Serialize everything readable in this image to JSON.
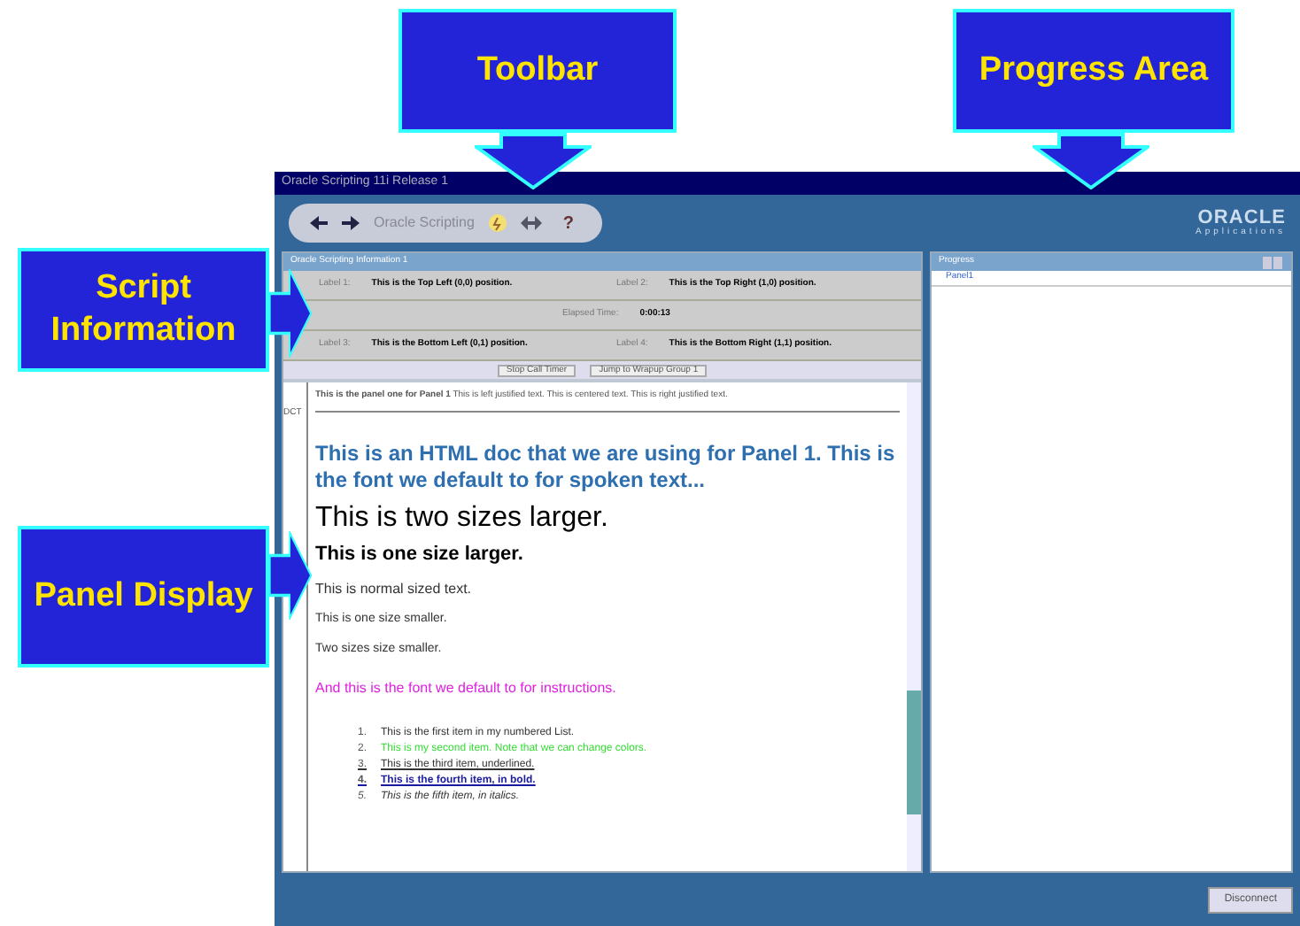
{
  "callouts": [
    {
      "label": "Toolbar",
      "kind": "down"
    },
    {
      "label": "Progress Area",
      "kind": "down"
    },
    {
      "label": "Script Information",
      "kind": "right"
    },
    {
      "label": "Panel Display",
      "kind": "right"
    }
  ],
  "window": {
    "title": "Oracle Scripting 11i Release 1"
  },
  "toolbar": {
    "title": "Oracle Scripting",
    "help": "?"
  },
  "logo": {
    "name": "ORACLE",
    "sub": "Applications"
  },
  "script_info": {
    "title": "Oracle Scripting Information 1",
    "rows": [
      {
        "kind": "pair",
        "cells": [
          {
            "label": "Label 1:",
            "value": "This is the Top Left (0,0) position."
          },
          {
            "label": "Label 2:",
            "value": "This is the Top Right (1,0) position."
          }
        ]
      },
      {
        "kind": "single",
        "label": "Elapsed Time:",
        "value": "0:00:13"
      },
      {
        "kind": "pair",
        "cells": [
          {
            "label": "Label 3:",
            "value": "This is the Bottom Left (0,1) position."
          },
          {
            "label": "Label 4:",
            "value": "This is the Bottom Right (1,1) position."
          }
        ]
      }
    ],
    "buttons": [
      "Stop Call Timer",
      "Jump to Wrapup Group 1"
    ]
  },
  "panel": {
    "side_label": "DCT",
    "header": "**This is the panel one for Panel 1** This is left justified text. This is centered text. This is right justified text.",
    "lines": [
      {
        "kind": "lead",
        "text": "This is an HTML doc that we are using for Panel 1. This is the font we default to for spoken text..."
      },
      {
        "kind": "large2",
        "text": "This is two sizes larger."
      },
      {
        "kind": "large1",
        "text": "This is one size larger."
      },
      {
        "kind": "normal",
        "text": "This is normal sized text."
      },
      {
        "kind": "small",
        "text": "This is one size smaller."
      },
      {
        "kind": "small",
        "text": "Two sizes size smaller."
      },
      {
        "kind": "magenta",
        "text": "And this is the font we default to for instructions."
      }
    ],
    "list": [
      {
        "kind": "plain",
        "number": "1.",
        "text": "This is the first item in my numbered List."
      },
      {
        "kind": "green",
        "number": "2.",
        "text": "This is my second item. Note that we can change colors."
      },
      {
        "kind": "underline",
        "number": "3.",
        "text": "This is the third item, underlined."
      },
      {
        "kind": "bold",
        "number": "4.",
        "text": "This is the fourth item, in bold."
      },
      {
        "kind": "italic",
        "number": "5.",
        "text": "This is the fifth item, in italics."
      }
    ]
  },
  "progress": {
    "title": "Progress",
    "items": [
      "Panel1"
    ]
  },
  "footer": {
    "button": "Disconnect"
  }
}
